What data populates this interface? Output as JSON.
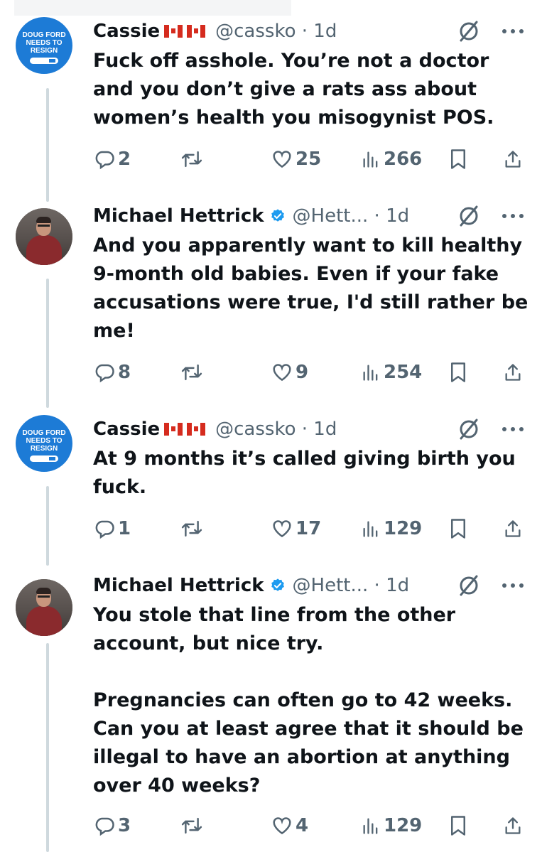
{
  "tweets": [
    {
      "name": "Cassie",
      "flags": [
        "ca",
        "ca"
      ],
      "verified": false,
      "handle": "@cassko",
      "time": "1d",
      "avatar_lines": [
        "DOUG FORD",
        "NEEDS TO",
        "RESIGN"
      ],
      "text": "Fuck off asshole. You’re not a doctor and you don’t give a rats ass about women’s health you misogynist POS.",
      "replies": "2",
      "likes": "25",
      "views": "266"
    },
    {
      "name": "Michael Hettrick",
      "flags": [],
      "verified": true,
      "handle": "@Hett...",
      "time": "1d",
      "text": "And you apparently want to kill healthy 9-month old babies. Even if your fake accusations were true, I'd still rather be me!",
      "replies": "8",
      "likes": "9",
      "views": "254"
    },
    {
      "name": "Cassie",
      "flags": [
        "ca",
        "ca"
      ],
      "verified": false,
      "handle": "@cassko",
      "time": "1d",
      "avatar_lines": [
        "DOUG FORD",
        "NEEDS TO",
        "RESIGN"
      ],
      "text": "At 9 months it’s called giving birth you fuck.",
      "replies": "1",
      "likes": "17",
      "views": "129"
    },
    {
      "name": "Michael Hettrick",
      "flags": [],
      "verified": true,
      "handle": "@Hett...",
      "time": "1d",
      "text": "You stole that line from the other account, but nice try.\n\nPregnancies can often go to 42 weeks. Can you at least agree that it should be illegal to have an abortion at anything over 40 weeks?",
      "replies": "3",
      "likes": "4",
      "views": "129"
    }
  ],
  "icons": {
    "reply": "reply-icon",
    "retweet": "retweet-icon",
    "like": "heart-icon",
    "views": "views-icon",
    "bookmark": "bookmark-icon",
    "share": "share-icon",
    "more": "more-icon",
    "grok": "slash-circle-icon",
    "verified": "verified-badge-icon"
  },
  "colors": {
    "text": "#0f1419",
    "secondary": "#536471",
    "verified": "#1d9bf0",
    "thread_line": "#cfd9de",
    "flag_red": "#d52b1e"
  }
}
